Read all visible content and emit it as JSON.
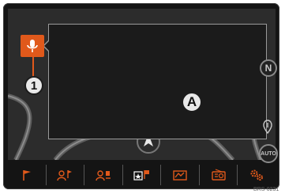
{
  "callouts": {
    "a": "A",
    "one": "1"
  },
  "side": {
    "compass": "N",
    "auto": "AUTO"
  },
  "icons": {
    "voice": "microphone-icon",
    "compass": "compass-north-icon",
    "side_pin": "map-pin-icon",
    "auto": "auto-zoom-icon",
    "position": "vehicle-position-icon"
  },
  "bottom_bar": [
    {
      "icon": "destination-flag-icon"
    },
    {
      "icon": "contact-destination-icon"
    },
    {
      "icon": "route-options-icon"
    },
    {
      "icon": "favorites-icon"
    },
    {
      "icon": "map-view-icon"
    },
    {
      "icon": "traffic-radio-icon"
    },
    {
      "icon": "settings-icon"
    }
  ],
  "ref": "BRS-0231",
  "colors": {
    "accent": "#e0591b",
    "screen": "#2c2c2c",
    "popup": "#1b1b1b"
  }
}
